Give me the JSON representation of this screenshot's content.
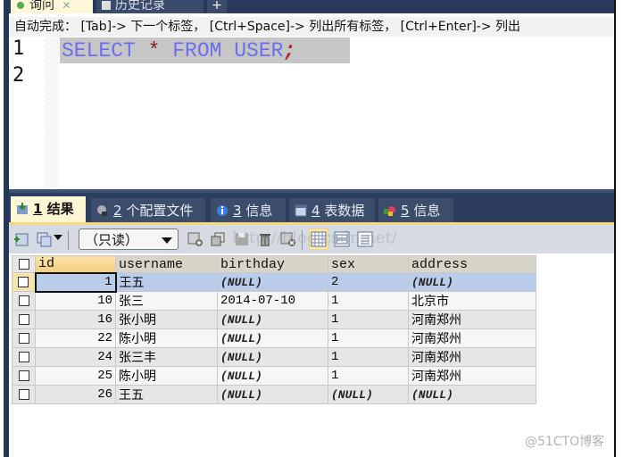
{
  "editor_tabs": [
    {
      "label": "询问",
      "icon": "query-icon",
      "closable": true,
      "active": true
    },
    {
      "label": "历史记录",
      "icon": "history-icon",
      "active": false
    },
    {
      "label": "+",
      "icon": "add-tab-icon",
      "active": false
    }
  ],
  "hint_bar": {
    "text": "自动完成： [Tab]-> 下一个标签， [Ctrl+Space]-> 列出所有标签， [Ctrl+Enter]-> 列出"
  },
  "editor": {
    "lines": [
      {
        "number": "1",
        "tokens": [
          {
            "text": "SELECT ",
            "kind": "keyword"
          },
          {
            "text": "*",
            "kind": "operator"
          },
          {
            "text": " FROM USER",
            "kind": "keyword"
          },
          {
            "text": ";",
            "kind": "terminator"
          }
        ]
      },
      {
        "number": "2",
        "tokens": []
      }
    ]
  },
  "result_tabs": [
    {
      "num": "1",
      "label": "结果",
      "icon": "result-icon",
      "active": true
    },
    {
      "num": "2",
      "label": "个配置文件",
      "icon": "profile-icon"
    },
    {
      "num": "3",
      "label": "信息",
      "icon": "info-icon"
    },
    {
      "num": "4",
      "label": "表数据",
      "icon": "table-data-icon"
    },
    {
      "num": "5",
      "label": "信息",
      "icon": "info-shapes-icon"
    }
  ],
  "toolbar": {
    "mode_select": "（只读）",
    "watermark": "http://blog.csdn.net/"
  },
  "grid": {
    "columns": [
      "id",
      "username",
      "birthday",
      "sex",
      "address"
    ],
    "rows": [
      {
        "id": "1",
        "username": "王五",
        "birthday": "(NULL)",
        "sex": "2",
        "address": "(NULL)",
        "selected": true
      },
      {
        "id": "10",
        "username": "张三",
        "birthday": "2014-07-10",
        "sex": "1",
        "address": "北京市"
      },
      {
        "id": "16",
        "username": "张小明",
        "birthday": "(NULL)",
        "sex": "1",
        "address": "河南郑州"
      },
      {
        "id": "22",
        "username": "陈小明",
        "birthday": "(NULL)",
        "sex": "1",
        "address": "河南郑州"
      },
      {
        "id": "24",
        "username": "张三丰",
        "birthday": "(NULL)",
        "sex": "1",
        "address": "河南郑州"
      },
      {
        "id": "25",
        "username": "陈小明",
        "birthday": "(NULL)",
        "sex": "1",
        "address": "河南郑州"
      },
      {
        "id": "26",
        "username": "王五",
        "birthday": "(NULL)",
        "sex": "(NULL)",
        "address": "(NULL)"
      }
    ]
  },
  "credit": "@51CTO博客"
}
